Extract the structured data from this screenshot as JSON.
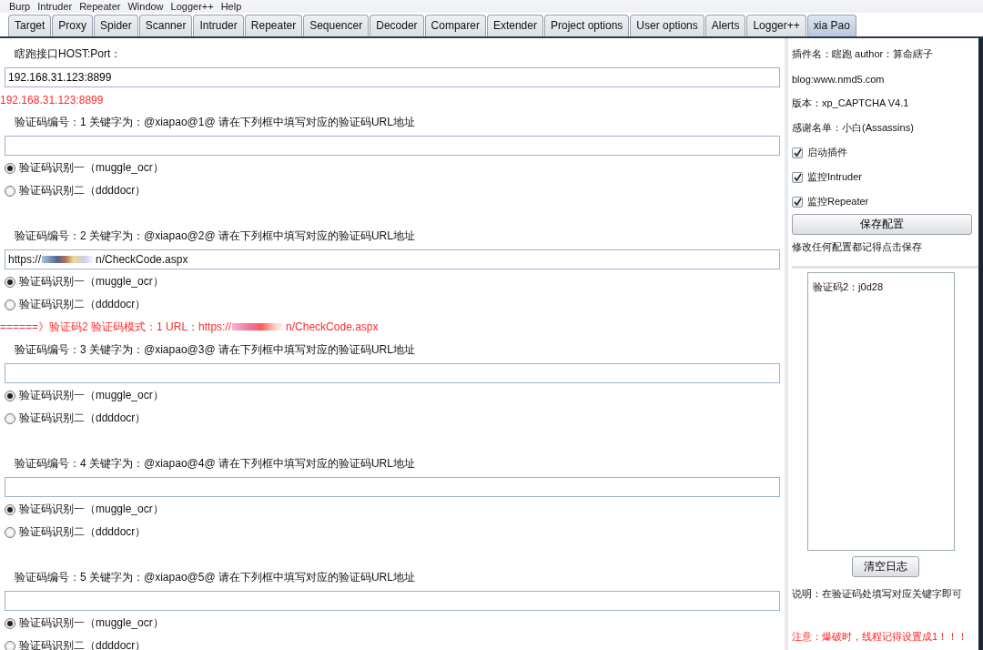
{
  "menu_bar": [
    "Burp",
    "Intruder",
    "Repeater",
    "Window",
    "Logger++",
    "Help"
  ],
  "tabs": [
    {
      "label": "Target",
      "selected": false
    },
    {
      "label": "Proxy",
      "selected": false
    },
    {
      "label": "Spider",
      "selected": false
    },
    {
      "label": "Scanner",
      "selected": false
    },
    {
      "label": "Intruder",
      "selected": false
    },
    {
      "label": "Repeater",
      "selected": false
    },
    {
      "label": "Sequencer",
      "selected": false
    },
    {
      "label": "Decoder",
      "selected": false
    },
    {
      "label": "Comparer",
      "selected": false
    },
    {
      "label": "Extender",
      "selected": false
    },
    {
      "label": "Project options",
      "selected": false
    },
    {
      "label": "User options",
      "selected": false
    },
    {
      "label": "Alerts",
      "selected": false
    },
    {
      "label": "Logger++",
      "selected": false
    },
    {
      "label": "xia Pao",
      "selected": true
    }
  ],
  "host": {
    "label": "瞎跑接口HOST:Port：",
    "value": "192.168.31.123:8899",
    "echo": "192.168.31.123:8899"
  },
  "sections": [
    {
      "label": "验证码编号：1  关键字为：@xiapao@1@    请在下列框中填写对应的验证码URL地址",
      "options": [
        {
          "label": "验证码识别一（muggle_ocr）",
          "selected": true
        },
        {
          "label": "验证码识别二（ddddocr）",
          "selected": false
        }
      ]
    },
    {
      "label": "验证码编号：2  关键字为：@xiapao@2@    请在下列框中填写对应的验证码URL地址",
      "url": {
        "prefix": "https://",
        "suffix": "n/CheckCode.aspx"
      },
      "options": [
        {
          "label": "验证码识别一（muggle_ocr）",
          "selected": true
        },
        {
          "label": "验证码识别二（ddddocr）",
          "selected": false
        }
      ],
      "log": {
        "prefix": "======》验证码2    验证码模式：1    URL：https://",
        "suffix": "n/CheckCode.aspx"
      }
    },
    {
      "label": "验证码编号：3  关键字为：@xiapao@3@    请在下列框中填写对应的验证码URL地址",
      "options": [
        {
          "label": "验证码识别一（muggle_ocr）",
          "selected": true
        },
        {
          "label": "验证码识别二（ddddocr）",
          "selected": false
        }
      ]
    },
    {
      "label": "验证码编号：4  关键字为：@xiapao@4@    请在下列框中填写对应的验证码URL地址",
      "options": [
        {
          "label": "验证码识别一（muggle_ocr）",
          "selected": true
        },
        {
          "label": "验证码识别二（ddddocr）",
          "selected": false
        }
      ]
    },
    {
      "label": "验证码编号：5  关键字为：@xiapao@5@    请在下列框中填写对应的验证码URL地址",
      "options": [
        {
          "label": "验证码识别一（muggle_ocr）",
          "selected": true
        },
        {
          "label": "验证码识别二（ddddocr）",
          "selected": false
        }
      ]
    }
  ],
  "side": {
    "info": [
      "插件名：瞎跑 author：算命縖子",
      "blog:www.nmd5.com",
      "版本：xp_CAPTCHA V4.1",
      "感谢名单：小白(Assassins)"
    ],
    "checkboxes": [
      {
        "label": "启动插件",
        "checked": true
      },
      {
        "label": "监控Intruder",
        "checked": true
      },
      {
        "label": "监控Repeater",
        "checked": true
      }
    ],
    "save_button": "保存配置",
    "save_hint": "修改任何配置都记得点击保存",
    "log_lines": [
      "验证码2：j0d28"
    ],
    "clear_button": "清空日志",
    "note": "说明：在验证码处填写对应关键字即可",
    "warning": "注意：爆破时，线程记得设置成1！！！"
  }
}
